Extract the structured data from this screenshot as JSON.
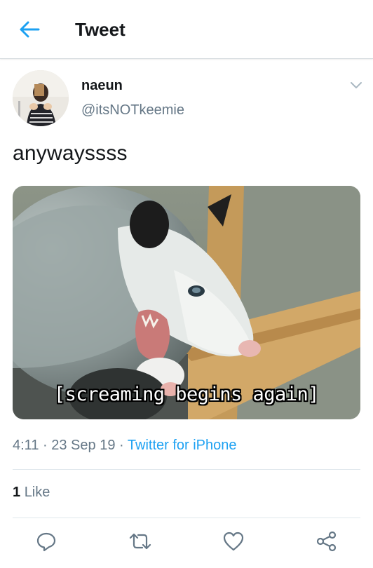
{
  "header": {
    "title": "Tweet",
    "back_icon": "arrow-left-icon"
  },
  "tweet": {
    "author": {
      "name": "naeun",
      "handle": "@itsNOTkeemie"
    },
    "text": "anywayssss",
    "media": {
      "caption": "[screaming begins again]"
    },
    "meta": {
      "time": "4:11",
      "date": "23 Sep 19",
      "source": "Twitter for iPhone",
      "separator": "·"
    },
    "likes": {
      "count": "1",
      "label": "Like"
    }
  },
  "actions": [
    {
      "name": "reply",
      "icon": "reply-icon"
    },
    {
      "name": "retweet",
      "icon": "retweet-icon"
    },
    {
      "name": "like",
      "icon": "heart-icon"
    },
    {
      "name": "share",
      "icon": "share-icon"
    }
  ],
  "colors": {
    "accent": "#1da1f2",
    "secondary_text": "#657786",
    "divider": "#e1e8ed",
    "icon": "#657786"
  }
}
